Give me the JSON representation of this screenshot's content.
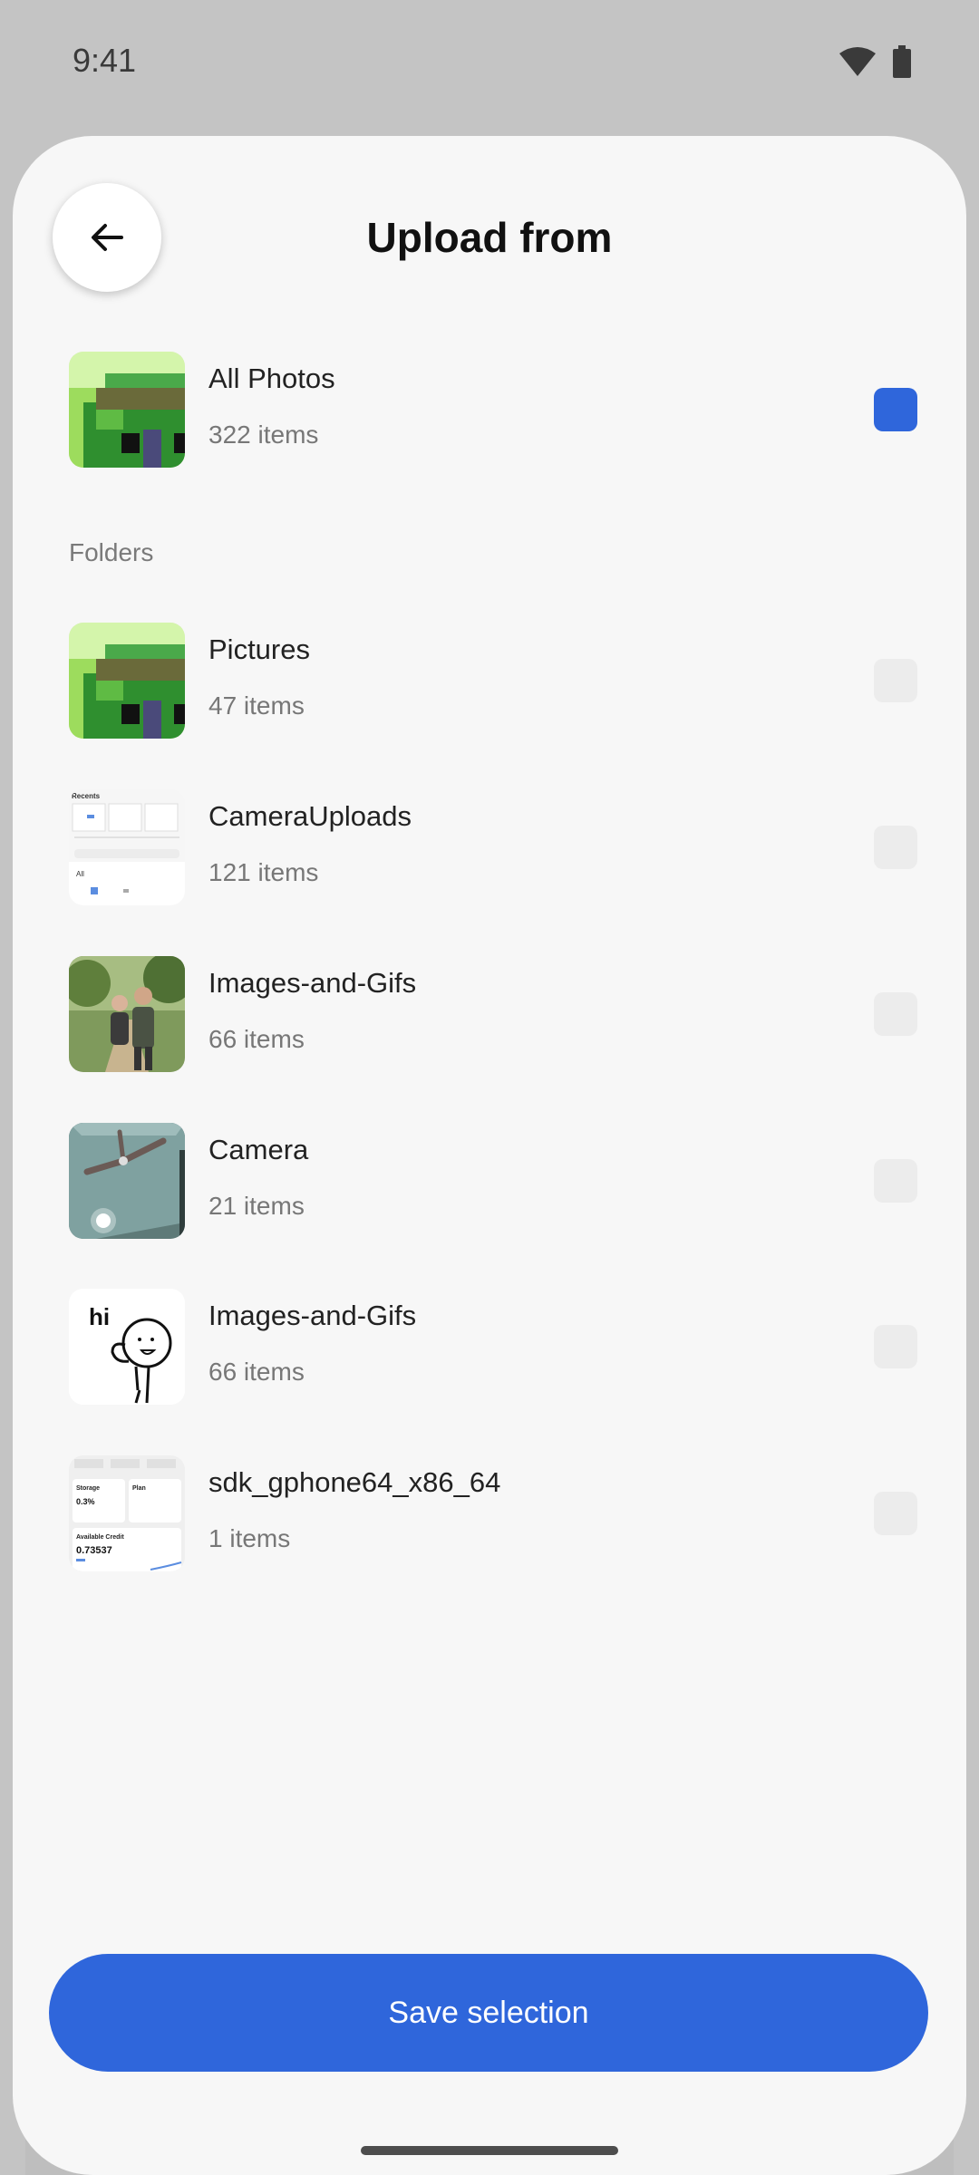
{
  "status_bar": {
    "time": "9:41",
    "icons": [
      "wifi-icon",
      "battery-icon"
    ]
  },
  "header": {
    "title": "Upload from",
    "back_icon": "arrow-left-icon"
  },
  "all_photos": {
    "name": "All Photos",
    "count": "322 items",
    "checked": true
  },
  "folders_label": "Folders",
  "folders": [
    {
      "name": "Pictures",
      "count": "47 items",
      "checked": false
    },
    {
      "name": "CameraUploads",
      "count": "121 items",
      "checked": false
    },
    {
      "name": "Images-and-Gifs",
      "count": "66 items",
      "checked": false
    },
    {
      "name": "Camera",
      "count": "21 items",
      "checked": false
    },
    {
      "name": "Images-and-Gifs",
      "count": "66 items",
      "checked": false
    },
    {
      "name": "sdk_gphone64_x86_64",
      "count": "1 items",
      "checked": false
    }
  ],
  "thumb_texts": {
    "hi": "hi",
    "recents": "Recents",
    "all": "All",
    "storage": "Storage",
    "storage_value": "0.3%",
    "plan": "Plan",
    "credit": "Available Credit",
    "credit_value": "0.73537"
  },
  "save_button": {
    "label": "Save selection"
  },
  "colors": {
    "accent": "#2f66db",
    "sheet": "#f7f7f7",
    "backdrop": "#c4c4c4"
  }
}
